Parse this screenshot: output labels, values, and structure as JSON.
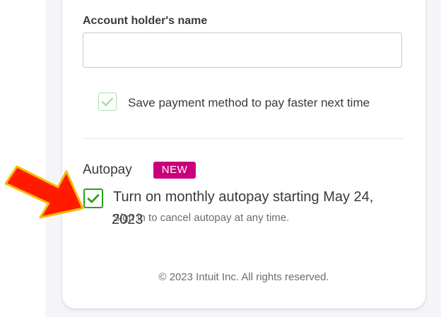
{
  "form": {
    "account_holder_label": "Account holder's name",
    "account_holder_value": "",
    "save_payment_label": "Save payment method to pay faster next time",
    "save_payment_checked": true
  },
  "autopay": {
    "heading": "Autopay",
    "badge": "NEW",
    "checkbox_label_line1": "Turn on monthly autopay starting May 24,",
    "checkbox_label_line2": "2023",
    "checked": true,
    "hint": "Sign in to cancel autopay at any time."
  },
  "footer": {
    "copyright": "© 2023 Intuit Inc. All rights reserved."
  },
  "annotation": {
    "arrow_icon": "red-arrow-icon",
    "arrow_fill": "#ff1a00",
    "arrow_outline": "#f5b800"
  },
  "colors": {
    "accent_green": "#2ca01c",
    "badge_magenta": "#c9007a",
    "text": "#393a3d"
  }
}
